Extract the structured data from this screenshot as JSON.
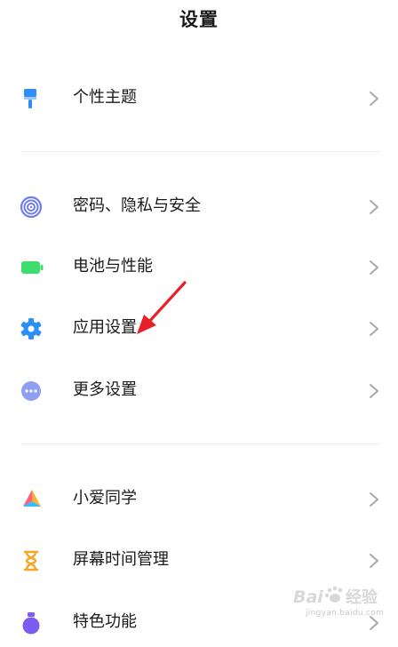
{
  "header": {
    "title": "设置"
  },
  "groups": [
    {
      "items": [
        {
          "label": "个性主题",
          "icon": "theme-brush-icon",
          "color": "#2f8ef7"
        }
      ]
    },
    {
      "items": [
        {
          "label": "密码、隐私与安全",
          "icon": "fingerprint-icon",
          "color": "#6e7cf5"
        },
        {
          "label": "电池与性能",
          "icon": "battery-icon",
          "color": "#3ddc6c"
        },
        {
          "label": "应用设置",
          "icon": "gear-icon",
          "color": "#2b8ff5"
        },
        {
          "label": "更多设置",
          "icon": "more-dots-icon",
          "color": "#8ea0f2"
        }
      ]
    },
    {
      "items": [
        {
          "label": "小爱同学",
          "icon": "xiaoai-icon",
          "color": "#ff5f7a"
        },
        {
          "label": "屏幕时间管理",
          "icon": "hourglass-icon",
          "color": "#f5a623"
        },
        {
          "label": "特色功能",
          "icon": "features-icon",
          "color": "#7b5cf0"
        }
      ]
    }
  ],
  "watermark": {
    "logo_text": "Baidu 经验",
    "url": "jingyan.baidu.com"
  },
  "colors": {
    "annotation_arrow": "#e8202a",
    "chevron": "#a8a8a8",
    "divider": "#ececec"
  }
}
